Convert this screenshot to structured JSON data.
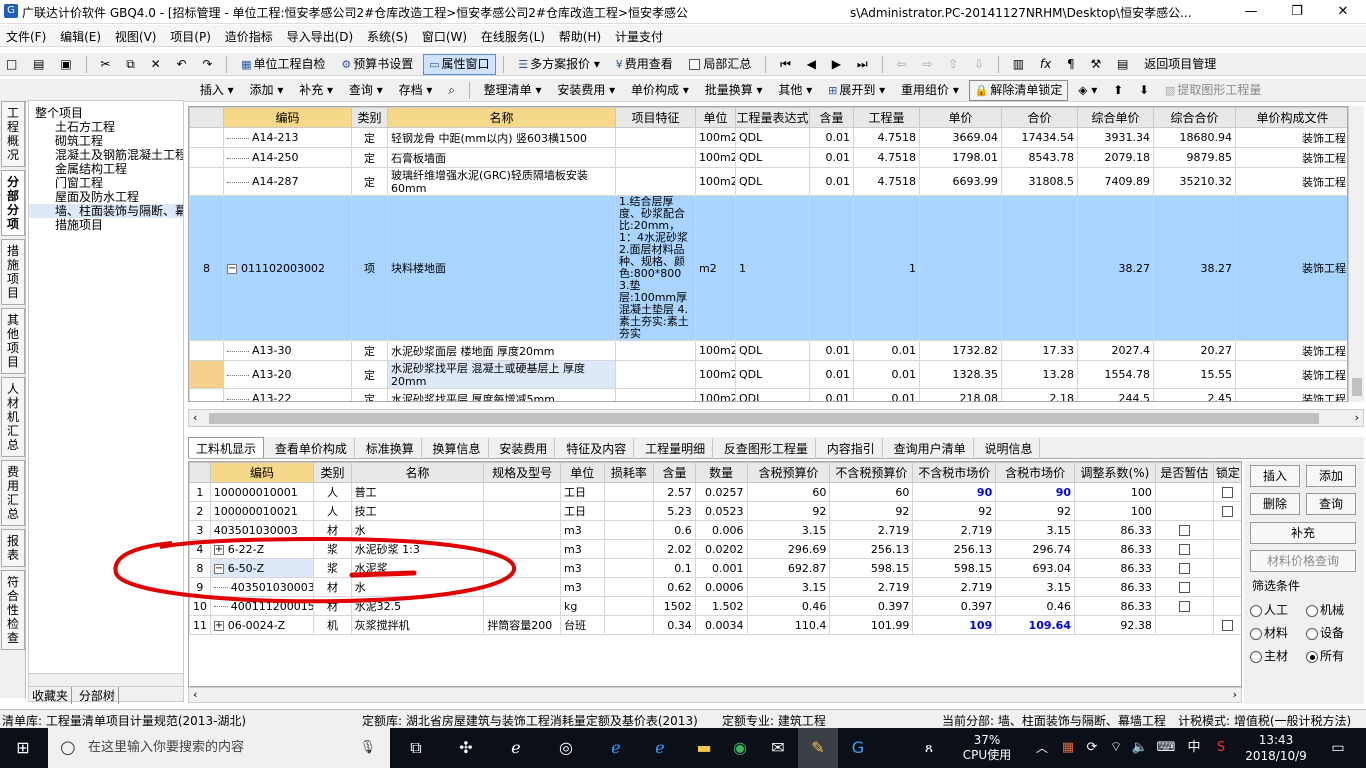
{
  "window": {
    "title": "广联达计价软件 GBQ4.0 - [招标管理 - 单位工程:恒安孝感公司2#仓库改造工程>恒安孝感公司2#仓库改造工程>恒安孝感公",
    "title_tail": "s\\Administrator.PC-20141127NRHM\\Desktop\\恒安孝感公...",
    "minimize": "—",
    "restore": "❐",
    "close": "✕"
  },
  "menu": [
    "文件(F)",
    "编辑(E)",
    "视图(V)",
    "项目(P)",
    "造价指标",
    "导入导出(D)",
    "系统(S)",
    "窗口(W)",
    "在线服务(L)",
    "帮助(H)",
    "计量支付"
  ],
  "toolbar1": {
    "unit_check": "单位工程自检",
    "budget_settings": "预算书设置",
    "property_window": "属性窗口",
    "multi_quote": "多方案报价",
    "fee_view": "费用查看",
    "partial_summary": "局部汇总",
    "return_project": "返回项目管理"
  },
  "toolbar2": [
    "插入",
    "添加",
    "补充",
    "查询",
    "存档",
    "整理清单",
    "安装费用",
    "单价构成",
    "批量换算",
    "其他",
    "展开到",
    "重用组价",
    "解除清单锁定",
    "提取图形工程量"
  ],
  "left_tabs": [
    "工程概况",
    "分部分项",
    "措施项目",
    "其他项目",
    "人材机汇总",
    "费用汇总",
    "报表",
    "符合性检查"
  ],
  "tree": {
    "root": "整个项目",
    "items": [
      "土石方工程",
      "砌筑工程",
      "混凝土及钢筋混凝土工程",
      "金属结构工程",
      "门窗工程",
      "屋面及防水工程",
      "墙、柱面装饰与隔断、幕墙工程",
      "措施项目"
    ],
    "bottom_tabs": [
      "收藏夹",
      "分部树"
    ]
  },
  "upper_table": {
    "headers": [
      "编码",
      "类别",
      "名称",
      "项目特征",
      "单位",
      "工程量表达式",
      "含量",
      "工程量",
      "单价",
      "合价",
      "综合单价",
      "综合合价",
      "单价构成文件"
    ],
    "rows": [
      {
        "no": "",
        "code": "A14-213",
        "type": "定",
        "name": "轻钢龙骨 中距(mm以内) 竖603横1500",
        "feature": "",
        "unit": "100m2",
        "expr": "QDL",
        "content": "0.01",
        "qty": "4.7518",
        "price": "3669.04",
        "total": "17434.54",
        "comp_price": "3931.34",
        "comp_total": "18680.94",
        "file": "装饰工程"
      },
      {
        "no": "",
        "code": "A14-250",
        "type": "定",
        "name": "石膏板墙面",
        "feature": "",
        "unit": "100m2",
        "expr": "QDL",
        "content": "0.01",
        "qty": "4.7518",
        "price": "1798.01",
        "total": "8543.78",
        "comp_price": "2079.18",
        "comp_total": "9879.85",
        "file": "装饰工程"
      },
      {
        "no": "",
        "code": "A14-287",
        "type": "定",
        "name": "玻璃纤维增强水泥(GRC)轻质隔墙板安装 60mm",
        "feature": "",
        "unit": "100m2",
        "expr": "QDL",
        "content": "0.01",
        "qty": "4.7518",
        "price": "6693.99",
        "total": "31808.5",
        "comp_price": "7409.89",
        "comp_total": "35210.32",
        "file": "装饰工程"
      },
      {
        "no": "8",
        "code": "011102003002",
        "type": "项",
        "name": "块料楼地面",
        "feature": "1.结合层厚度、砂浆配合比:20mm，1：4水泥砂浆\n2.面层材料品种、规格、颜色:800*800\n3.垫层:100mm厚混凝土垫层\n4.素土夯实:素土夯实",
        "unit": "m2",
        "expr": "1",
        "content": "",
        "qty": "1",
        "price": "",
        "total": "",
        "comp_price": "38.27",
        "comp_total": "38.27",
        "file": "装饰工程"
      },
      {
        "no": "",
        "code": "A13-30",
        "type": "定",
        "name": "水泥砂浆面层 楼地面 厚度20mm",
        "feature": "",
        "unit": "100m2",
        "expr": "QDL",
        "content": "0.01",
        "qty": "0.01",
        "price": "1732.82",
        "total": "17.33",
        "comp_price": "2027.4",
        "comp_total": "20.27",
        "file": "装饰工程"
      },
      {
        "no": "",
        "code": "A13-20",
        "type": "定",
        "name": "水泥砂浆找平层 混凝土或硬基层上 厚度20mm",
        "feature": "",
        "unit": "100m2",
        "expr": "QDL",
        "content": "0.01",
        "qty": "0.01",
        "price": "1328.35",
        "total": "13.28",
        "comp_price": "1554.78",
        "comp_total": "15.55",
        "file": "装饰工程"
      },
      {
        "no": "",
        "code": "A13-22",
        "type": "定",
        "name": "水泥砂浆找平层 厚度每增减5mm",
        "feature": "",
        "unit": "100m2",
        "expr": "QDL",
        "content": "0.01",
        "qty": "0.01",
        "price": "218.08",
        "total": "2.18",
        "comp_price": "244.5",
        "comp_total": "2.45",
        "file": "装饰工程"
      }
    ]
  },
  "lower_tabs": [
    "工料机显示",
    "查看单价构成",
    "标准换算",
    "换算信息",
    "安装费用",
    "特征及内容",
    "工程量明细",
    "反查图形工程量",
    "内容指引",
    "查询用户清单",
    "说明信息"
  ],
  "lower_table": {
    "headers": [
      "编码",
      "类别",
      "名称",
      "规格及型号",
      "单位",
      "损耗率",
      "含量",
      "数量",
      "含税预算价",
      "不含税预算价",
      "不含税市场价",
      "含税市场价",
      "调整系数(%)",
      "是否暂估",
      "锁定"
    ],
    "rows": [
      {
        "no": "1",
        "exp": "",
        "code": "100000010001",
        "type": "人",
        "name": "普工",
        "spec": "",
        "unit": "工日",
        "loss": "",
        "content": "2.57",
        "qty": "0.0257",
        "tax_budget": "60",
        "notax_budget": "60",
        "notax_market": "90",
        "tax_market": "90",
        "coef": "100",
        "est": false
      },
      {
        "no": "2",
        "exp": "",
        "code": "100000010021",
        "type": "人",
        "name": "技工",
        "spec": "",
        "unit": "工日",
        "loss": "",
        "content": "5.23",
        "qty": "0.0523",
        "tax_budget": "92",
        "notax_budget": "92",
        "notax_market": "92",
        "tax_market": "92",
        "coef": "100",
        "est": false
      },
      {
        "no": "3",
        "exp": "",
        "code": "403501030003",
        "type": "材",
        "name": "水",
        "spec": "",
        "unit": "m3",
        "loss": "",
        "content": "0.6",
        "qty": "0.006",
        "tax_budget": "3.15",
        "notax_budget": "2.719",
        "notax_market": "2.719",
        "tax_market": "3.15",
        "coef": "86.33",
        "est": true
      },
      {
        "no": "4",
        "exp": "+",
        "code": "6-22-Z",
        "type": "浆",
        "name": "水泥砂浆 1:3",
        "spec": "",
        "unit": "m3",
        "loss": "",
        "content": "2.02",
        "qty": "0.0202",
        "tax_budget": "296.69",
        "notax_budget": "256.13",
        "notax_market": "256.13",
        "tax_market": "296.74",
        "coef": "86.33",
        "est": true
      },
      {
        "no": "8",
        "exp": "−",
        "code": "6-50-Z",
        "type": "浆",
        "name": "水泥浆",
        "spec": "",
        "unit": "m3",
        "loss": "",
        "content": "0.1",
        "qty": "0.001",
        "tax_budget": "692.87",
        "notax_budget": "598.15",
        "notax_market": "598.15",
        "tax_market": "693.04",
        "coef": "86.33",
        "est": true
      },
      {
        "no": "9",
        "exp": "",
        "code": "403501030003",
        "type": "材",
        "name": "水",
        "spec": "",
        "unit": "m3",
        "loss": "",
        "content": "0.62",
        "qty": "0.0006",
        "tax_budget": "3.15",
        "notax_budget": "2.719",
        "notax_market": "2.719",
        "tax_market": "3.15",
        "coef": "86.33",
        "est": true
      },
      {
        "no": "10",
        "exp": "",
        "code": "400111200015",
        "type": "材",
        "name": "水泥32.5",
        "spec": "",
        "unit": "kg",
        "loss": "",
        "content": "1502",
        "qty": "1.502",
        "tax_budget": "0.46",
        "notax_budget": "0.397",
        "notax_market": "0.397",
        "tax_market": "0.46",
        "coef": "86.33",
        "est": true
      },
      {
        "no": "11",
        "exp": "+",
        "code": "06-0024-Z",
        "type": "机",
        "name": "灰浆搅拌机",
        "spec": "拌筒容量200",
        "unit": "台班",
        "loss": "",
        "content": "0.34",
        "qty": "0.0034",
        "tax_budget": "110.4",
        "notax_budget": "101.99",
        "notax_market": "109",
        "tax_market": "109.64",
        "coef": "92.38",
        "est": false
      }
    ]
  },
  "right_panel": {
    "insert": "插入",
    "add": "添加",
    "delete": "删除",
    "query": "查询",
    "supplement": "补充",
    "price_query": "材料价格查询",
    "filter_title": "筛选条件",
    "filters": [
      "人工",
      "机械",
      "材料",
      "设备",
      "主材",
      "所有"
    ],
    "selected_filter": "所有"
  },
  "statusbar": {
    "list_lib": "清单库:  工程量清单项目计量规范(2013-湖北)",
    "quota_lib": "定额库:  湖北省房屋建筑与装饰工程消耗量定额及基价表(2013)",
    "quota_major": "定额专业:  建筑工程",
    "current_section": "当前分部:  墙、柱面装饰与隔断、幕墙工程",
    "tax_mode": "计税模式:  增值税(一般计税方法)"
  },
  "taskbar": {
    "search_placeholder": "在这里输入你要搜索的内容",
    "cpu": "37%",
    "cpu_label": "CPU使用",
    "ime": "中",
    "time": "13:43",
    "date": "2018/10/9"
  },
  "colors": {
    "selected_row": "#a8d4ff",
    "header_yellow": "#f5d88a",
    "annotation": "#e00000",
    "price_blue": "#0000e0"
  }
}
